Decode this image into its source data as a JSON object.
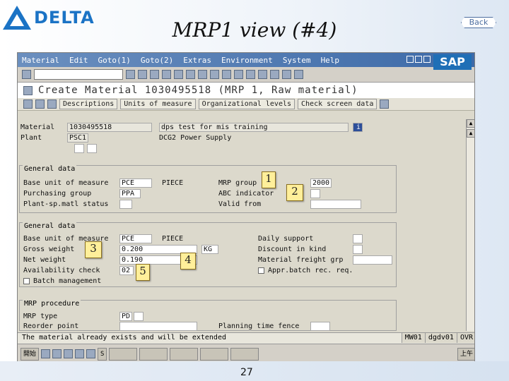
{
  "slide": {
    "logo_text": "DELTA",
    "title": "MRP1 view (#4)",
    "back_label": "Back",
    "page_number": "27"
  },
  "sap": {
    "menu": [
      "Material",
      "Edit",
      "Goto(1)",
      "Goto(2)",
      "Extras",
      "Environment",
      "System",
      "Help"
    ],
    "logo": "SAP",
    "screen_title": "Create Material 1030495518 (MRP 1, Raw material)",
    "app_toolbar": [
      "Descriptions",
      "Units of measure",
      "Organizational levels",
      "Check screen data"
    ],
    "header": {
      "material_label": "Material",
      "material_value": "1030495518",
      "material_desc": "dps test for mis training",
      "plant_label": "Plant",
      "plant_value": "PSC1",
      "plant_desc": "DCG2 Power Supply",
      "info_icon": "info-icon"
    },
    "general1": {
      "title": "General data",
      "base_uom_label": "Base unit of measure",
      "base_uom_value": "PCE",
      "base_uom_text": "PIECE",
      "purchasing_group_label": "Purchasing group",
      "purchasing_group_value": "PPA",
      "plant_sp_status_label": "Plant-sp.matl status",
      "mrp_group_label": "MRP group",
      "mrp_group_value": "2000",
      "abc_label": "ABC indicator",
      "valid_from_label": "Valid from"
    },
    "general2": {
      "title": "General data",
      "base_uom_label": "Base unit of measure",
      "base_uom_value": "PCE",
      "base_uom_text": "PIECE",
      "gross_weight_label": "Gross weight",
      "gross_weight_value": "0.200",
      "weight_unit": "KG",
      "net_weight_label": "Net weight",
      "net_weight_value": "0.190",
      "availability_check_label": "Availability check",
      "availability_check_value": "02",
      "batch_label": "Batch management",
      "daily_support_label": "Daily support",
      "discount_label": "Discount in kind",
      "freight_group_label": "Material freight grp",
      "approved_batch_label": "Appr.batch rec. req."
    },
    "mrp_procedure": {
      "title": "MRP procedure",
      "mrp_type_label": "MRP type",
      "mrp_type_value": "PD",
      "reorder_point_label": "Reorder point",
      "planning_fence_label": "Planning time fence"
    },
    "status": {
      "message": "The material already exists and will be extended",
      "system": "MW01",
      "server": "dgdv01",
      "mode": "OVR"
    },
    "taskbar": [
      "開始",
      "S",
      "上午"
    ]
  },
  "callouts": [
    "1",
    "2",
    "3",
    "4",
    "5"
  ]
}
